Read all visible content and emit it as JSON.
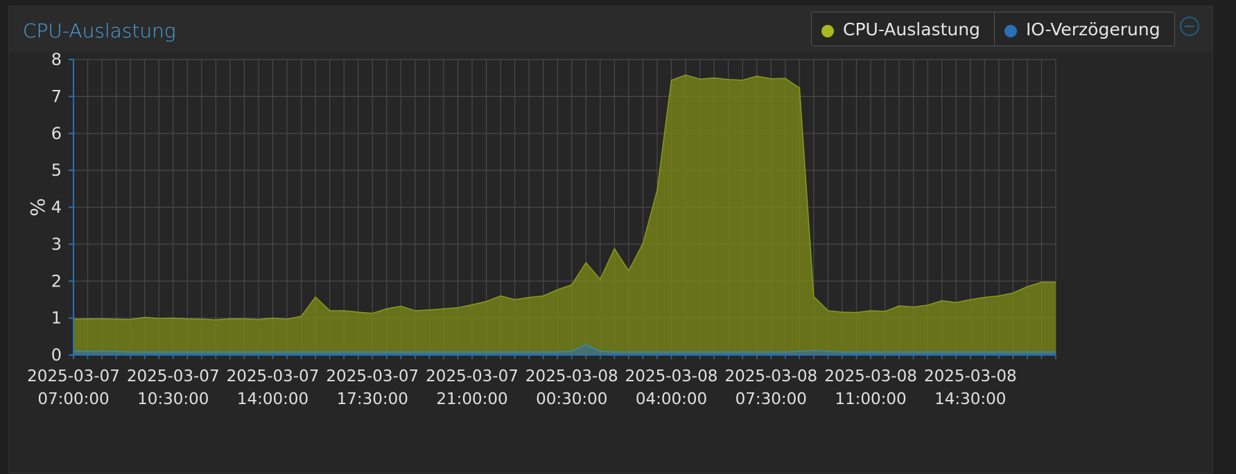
{
  "panel": {
    "title": "CPU-Auslastung",
    "legend": [
      {
        "label": "CPU-Auslastung",
        "color": "#a8b820"
      },
      {
        "label": "IO-Verzögerung",
        "color": "#2a6fb5"
      }
    ],
    "collapse_icon": "minus-circle-icon"
  },
  "chart_data": {
    "type": "area",
    "title": "",
    "ylabel": "%",
    "xlabel": "",
    "ylim": [
      0,
      8
    ],
    "yticks": [
      0,
      1,
      2,
      3,
      4,
      5,
      6,
      7,
      8
    ],
    "grid": true,
    "x_tick_labels": [
      {
        "date": "2025-03-07",
        "time": "07:00:00",
        "index": 0
      },
      {
        "date": "2025-03-07",
        "time": "10:30:00",
        "index": 7
      },
      {
        "date": "2025-03-07",
        "time": "14:00:00",
        "index": 14
      },
      {
        "date": "2025-03-07",
        "time": "17:30:00",
        "index": 21
      },
      {
        "date": "2025-03-07",
        "time": "21:00:00",
        "index": 28
      },
      {
        "date": "2025-03-08",
        "time": "00:30:00",
        "index": 35
      },
      {
        "date": "2025-03-08",
        "time": "04:00:00",
        "index": 42
      },
      {
        "date": "2025-03-08",
        "time": "07:30:00",
        "index": 49
      },
      {
        "date": "2025-03-08",
        "time": "11:00:00",
        "index": 56
      },
      {
        "date": "2025-03-08",
        "time": "14:30:00",
        "index": 63
      }
    ],
    "x_interval_minutes": 30,
    "series": [
      {
        "name": "CPU-Auslastung",
        "color": "#a8b820",
        "values": [
          0.97,
          0.98,
          0.98,
          0.97,
          0.96,
          1.02,
          0.99,
          1.0,
          0.98,
          0.97,
          0.95,
          0.98,
          0.98,
          0.96,
          1.0,
          0.97,
          1.05,
          1.57,
          1.2,
          1.2,
          1.16,
          1.13,
          1.25,
          1.32,
          1.2,
          1.22,
          1.25,
          1.28,
          1.36,
          1.45,
          1.6,
          1.5,
          1.56,
          1.6,
          1.77,
          1.9,
          2.5,
          2.05,
          2.88,
          2.28,
          3.02,
          4.46,
          7.44,
          7.58,
          7.47,
          7.5,
          7.46,
          7.44,
          7.55,
          7.48,
          7.49,
          7.23,
          1.58,
          1.2,
          1.16,
          1.15,
          1.2,
          1.18,
          1.33,
          1.3,
          1.35,
          1.47,
          1.42,
          1.5,
          1.56,
          1.6,
          1.68,
          1.85,
          1.97,
          1.97
        ]
      },
      {
        "name": "IO-Verzögerung",
        "color": "#2a6fb5",
        "values": [
          0.1,
          0.1,
          0.1,
          0.1,
          0.08,
          0.08,
          0.08,
          0.08,
          0.08,
          0.08,
          0.08,
          0.08,
          0.08,
          0.08,
          0.08,
          0.08,
          0.08,
          0.08,
          0.08,
          0.08,
          0.08,
          0.08,
          0.08,
          0.08,
          0.08,
          0.08,
          0.08,
          0.08,
          0.08,
          0.08,
          0.08,
          0.08,
          0.08,
          0.08,
          0.08,
          0.1,
          0.28,
          0.1,
          0.08,
          0.08,
          0.08,
          0.08,
          0.08,
          0.08,
          0.08,
          0.08,
          0.08,
          0.08,
          0.08,
          0.08,
          0.08,
          0.1,
          0.12,
          0.1,
          0.08,
          0.08,
          0.08,
          0.08,
          0.08,
          0.08,
          0.08,
          0.08,
          0.08,
          0.08,
          0.08,
          0.08,
          0.08,
          0.08,
          0.08,
          0.08
        ]
      }
    ]
  }
}
